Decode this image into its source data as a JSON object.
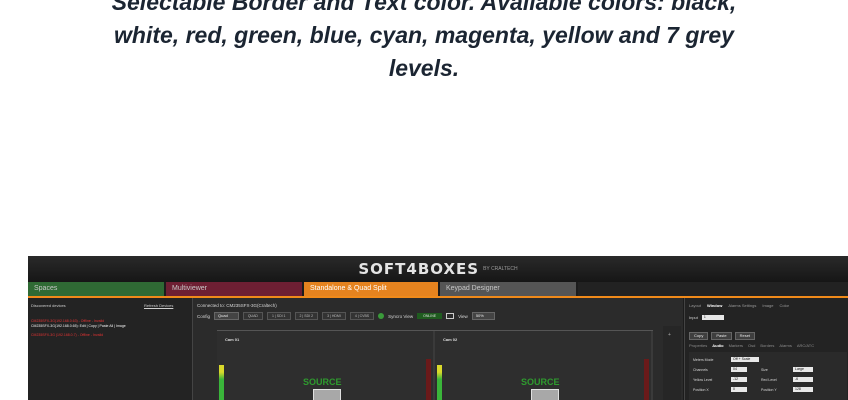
{
  "headline": {
    "line1": "Selectable Border and Text color. Available colors: black,",
    "line2": "white, red, green, blue, cyan, magenta, yellow and 7 grey",
    "line3": "levels."
  },
  "app": {
    "brand": "SOFT4BOXES",
    "brand_sub": "BY CRALTECH",
    "accent_color": "#f08a1a",
    "tabs": [
      "Spaces",
      "Multiviewer",
      "Standalone & Quad Split",
      "Keypad Designer"
    ],
    "left": {
      "header": "Discovered devices",
      "refresh": "Refresh Devices",
      "devices": [
        "CM235SFX-3G(192.168.0.63) - Offline - Invalid",
        "CM235SFX-3G(192.168.0.65): Edit | Copy | Paste All | Image",
        "CM235SFX-3G (192.168.0.7) - Offline - Invalid"
      ]
    },
    "center": {
      "connected": "Connected to: CM235SFX-3G(Craltech)",
      "config_label": "Config",
      "config_value": "Quad",
      "segments": [
        "QUAD",
        "1 | SDI 1",
        "2 | SDI 2",
        "3 | HDMI",
        "4 | CVBS"
      ],
      "sync_label": "Syncro View",
      "online": "ONLINE",
      "view_label": "View",
      "view_value": "50%",
      "panes": [
        {
          "label": "Cam 01",
          "source": "SOURCE"
        },
        {
          "label": "Cam 02",
          "source": "SOURCE"
        }
      ]
    },
    "right": {
      "tabs": [
        "Layout",
        "Window",
        "Alarms Settings",
        "Image",
        "Color"
      ],
      "input_label": "Input",
      "input_value": "1",
      "buttons": [
        "Copy",
        "Paste",
        "Reset"
      ],
      "subtabs": [
        "Properties",
        "Audio",
        "Markers",
        "Osd",
        "Borders",
        "Alarms",
        "ARC/ATC"
      ],
      "props": [
        {
          "l1": "Meters Mode",
          "v1": "Off + Scale",
          "l2": "",
          "v2": ""
        },
        {
          "l1": "Channels",
          "v1": "04",
          "l2": "Size",
          "v2": "Large"
        },
        {
          "l1": "Yellow Level",
          "v1": "-12",
          "l2": "Red Level",
          "v2": "-6"
        },
        {
          "l1": "Position X",
          "v1": "0",
          "l2": "Position Y",
          "v2": "128"
        }
      ]
    }
  }
}
